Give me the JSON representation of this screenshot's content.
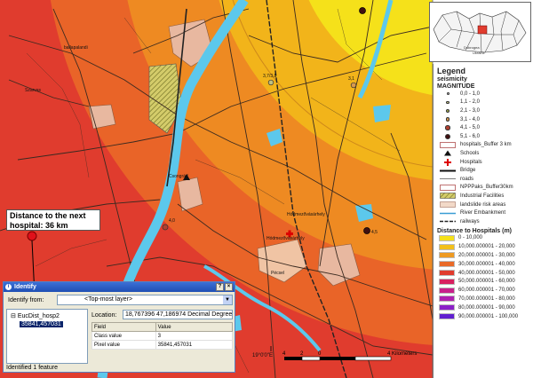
{
  "colors": {
    "ring_0_10k": "#f5e11a",
    "ring_10_20k": "#f2b41a",
    "ring_20_30k": "#ee8a22",
    "ring_30_40k": "#e96428",
    "ring_40_50k": "#e03c2e",
    "river": "#5cc8ec",
    "road": "#3a2a20",
    "industrial": "#c8c860",
    "settlement": "#e8b8a0"
  },
  "map": {
    "place_labels": [
      {
        "name": "ballapalandi",
        "kind": "settlement"
      },
      {
        "name": "Szarvas",
        "kind": "settlement"
      },
      {
        "name": "Csongrád",
        "kind": "settlement"
      },
      {
        "name": "Hódmezővásárhely",
        "kind": "settlement"
      },
      {
        "name": "Hódmezővásárhely",
        "kind": "settlement"
      },
      {
        "name": "Pécsel",
        "kind": "settlement"
      }
    ],
    "quake_labels": [
      "3,7/3,8",
      "3,1",
      "4,0",
      "4,5"
    ],
    "callout": {
      "line1": "Distance to the next",
      "line2": "hospital: 36 km"
    },
    "graticule_label": "19°0'0\"E"
  },
  "scalebar": {
    "ticks": [
      "4",
      "2",
      "0",
      "4 Kilometers"
    ]
  },
  "inset": {
    "labels": [
      "Dobrogea",
      "Ukraine"
    ]
  },
  "legend": {
    "title": "Legend",
    "seismicity_header": "seismicity",
    "magnitude_header": "MAGNITUDE",
    "magnitude_classes": [
      {
        "label": "0,0 - 1,0",
        "color": "#d8d8d8"
      },
      {
        "label": "1,1 - 2,0",
        "color": "#c0c080"
      },
      {
        "label": "2,1 - 3,0",
        "color": "#a8b050"
      },
      {
        "label": "3,1 - 4,0",
        "color": "#d89a50"
      },
      {
        "label": "4,1 - 5,0",
        "color": "#b04030"
      },
      {
        "label": "5,1 - 6,0",
        "color": "#401010"
      }
    ],
    "layers": [
      {
        "label": "hospitals_Buffer 3 km",
        "symbol": "box"
      },
      {
        "label": "Schools",
        "symbol": "triangle-icon"
      },
      {
        "label": "Hospitals",
        "symbol": "red-cross-icon"
      },
      {
        "label": "Bridge",
        "symbol": "line-thick"
      },
      {
        "label": "roads",
        "symbol": "line-thin"
      },
      {
        "label": "NPPPaks_Buffer30km",
        "symbol": "box"
      },
      {
        "label": "Industrial Facilities",
        "symbol": "hatch"
      },
      {
        "label": "landslide risk areas",
        "symbol": "box-light"
      },
      {
        "label": "River Embankment",
        "symbol": "line-blue"
      },
      {
        "label": "railways",
        "symbol": "rail"
      }
    ],
    "distance_header": "Distance to Hospitals (m)",
    "distance_classes": [
      {
        "label": "0 - 10,000",
        "color": "#f5e11a"
      },
      {
        "label": "10,000.000001 - 20,000",
        "color": "#f2c01a"
      },
      {
        "label": "20,000.000001 - 30,000",
        "color": "#ee9a22"
      },
      {
        "label": "30,000.000001 - 40,000",
        "color": "#e96a28"
      },
      {
        "label": "40,000.000001 - 50,000",
        "color": "#e03c2e"
      },
      {
        "label": "50,000.000001 - 60,000",
        "color": "#d82060"
      },
      {
        "label": "60,000.000001 - 70,000",
        "color": "#c8208a"
      },
      {
        "label": "70,000.000001 - 80,000",
        "color": "#b020b0"
      },
      {
        "label": "80,000.000001 - 90,000",
        "color": "#8a20c8"
      },
      {
        "label": "90,000.000001 - 100,000",
        "color": "#6020d0"
      }
    ]
  },
  "identify": {
    "title": "Identify",
    "help_btn": "?",
    "close_btn": "×",
    "identify_from_label": "Identify from:",
    "identify_from_value": "<Top-most layer>",
    "tree_node": "EucDist_hosp2",
    "tree_child": "35841,457031",
    "location_label": "Location:",
    "location_value": "18,767396 47,186974 Decimal Degrees",
    "columns": [
      "Field",
      "Value"
    ],
    "rows": [
      {
        "field": "Class value",
        "value": "3"
      },
      {
        "field": "Pixel value",
        "value": "35841,457031"
      }
    ],
    "status": "Identified 1 feature"
  }
}
